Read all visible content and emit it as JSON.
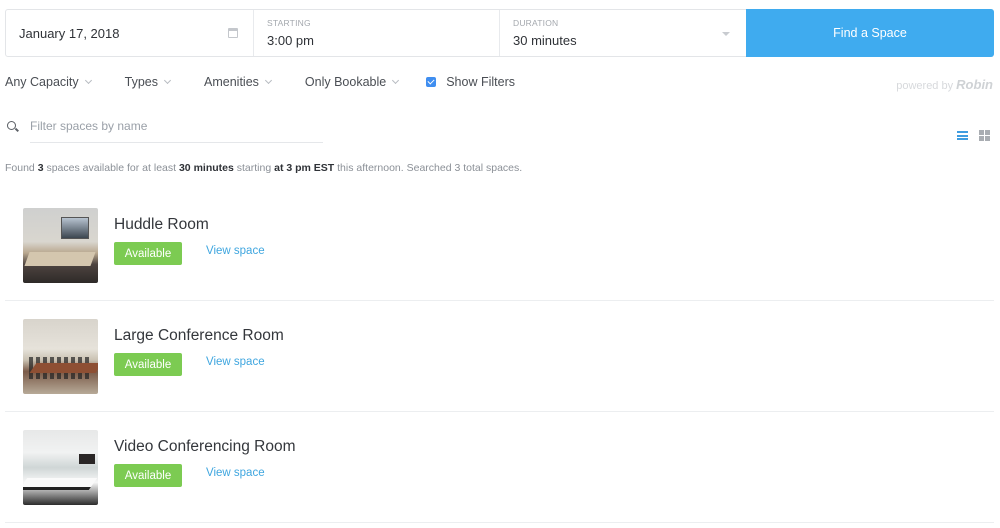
{
  "search": {
    "date_value": "January 17, 2018",
    "date_icon": "calendar-icon",
    "starting_label": "STARTING",
    "starting_value": "3:00 pm",
    "duration_label": "DURATION",
    "duration_value": "30 minutes",
    "duration_icon": "caret-down-icon",
    "find_button": "Find a Space",
    "accent_color": "#3fabef"
  },
  "filters": {
    "items": [
      {
        "label": "Any Capacity"
      },
      {
        "label": "Types"
      },
      {
        "label": "Amenities"
      },
      {
        "label": "Only Bookable"
      }
    ],
    "show_filters_label": "Show Filters",
    "show_filters_checked": true
  },
  "branding": {
    "powered_by": "powered by",
    "brand": "Robin"
  },
  "name_filter": {
    "placeholder": "Filter spaces by name",
    "value": ""
  },
  "view_toggle": {
    "active": "list",
    "options": [
      "list",
      "grid"
    ]
  },
  "summary": {
    "prefix": "Found ",
    "count": "3",
    "mid1": " spaces available for at least ",
    "duration": "30 minutes",
    "mid2": " starting ",
    "time": "at 3 pm EST",
    "suffix": " this afternoon. Searched 3 total spaces."
  },
  "spaces": [
    {
      "name": "Huddle Room",
      "status": "Available",
      "link": "View space"
    },
    {
      "name": "Large Conference Room",
      "status": "Available",
      "link": "View space"
    },
    {
      "name": "Video Conferencing Room",
      "status": "Available",
      "link": "View space"
    }
  ],
  "colors": {
    "available_badge": "#7ccb52",
    "link": "#3fa6df",
    "checkbox": "#3f8ef0"
  }
}
